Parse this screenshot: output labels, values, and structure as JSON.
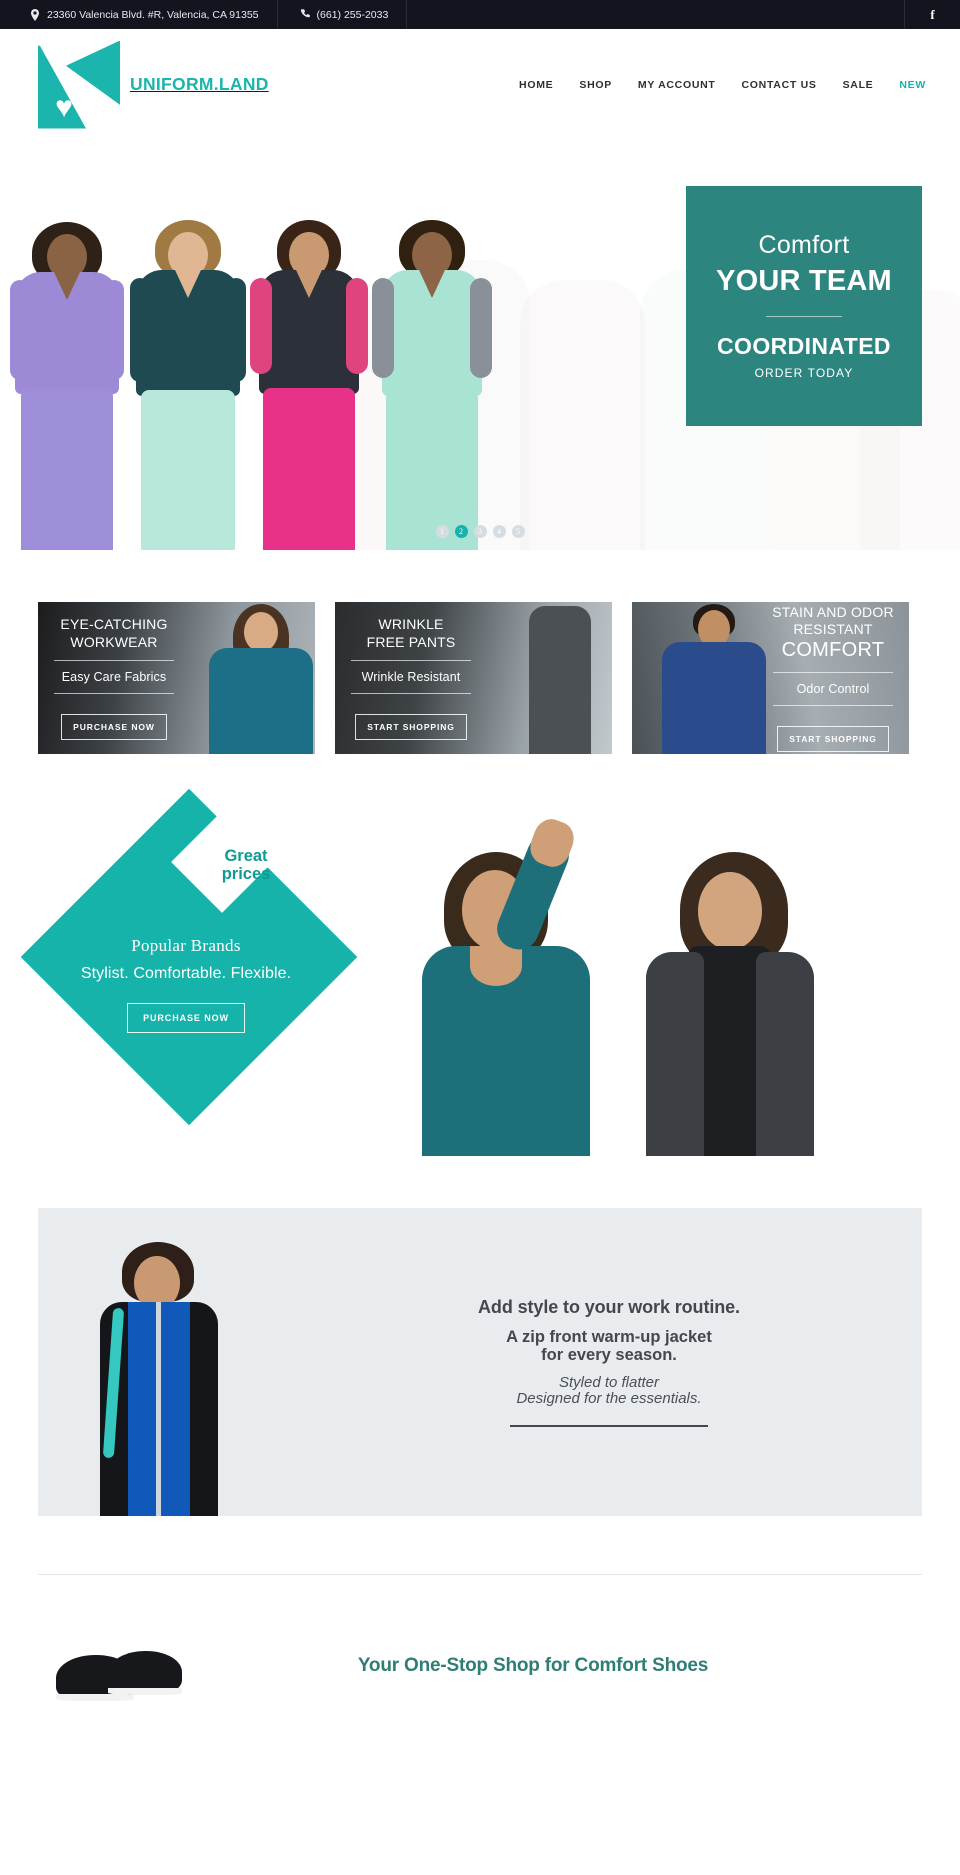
{
  "topbar": {
    "address": "23360 Valencia Blvd. #R, Valencia, CA 91355",
    "phone": "(661) 255-2033",
    "address_icon": "map-pin-icon",
    "phone_icon": "phone-icon",
    "social_icon": "facebook-icon",
    "facebook_glyph": "f",
    "bg_color": "#14141f"
  },
  "header": {
    "brand_name": "UNIFORM.LAND",
    "brand_color": "#1bb5ad",
    "nav": [
      {
        "label": "HOME",
        "active": false
      },
      {
        "label": "SHOP",
        "active": false
      },
      {
        "label": "MY ACCOUNT",
        "active": false
      },
      {
        "label": "CONTACT US",
        "active": false
      },
      {
        "label": "SALE",
        "active": false
      },
      {
        "label": "NEW",
        "active": true
      }
    ]
  },
  "hero": {
    "card": {
      "line1": "Comfort",
      "line2": "YOUR TEAM",
      "line3": "COORDINATED",
      "line4": "ORDER TODAY",
      "bg_color": "#2d8580"
    },
    "dots": [
      {
        "label": "1",
        "active": false
      },
      {
        "label": "2",
        "active": true
      },
      {
        "label": "3",
        "active": false
      },
      {
        "label": "4",
        "active": false
      },
      {
        "label": "5",
        "active": false
      }
    ],
    "active_dot_color": "#16b3ab"
  },
  "promos": [
    {
      "title": "EYE-CATCHING\nWORKWEAR",
      "title_line1": "EYE-CATCHING",
      "title_line2": "WORKWEAR",
      "subtitle": "Easy Care Fabrics",
      "button": "PURCHASE NOW"
    },
    {
      "title_line1": "WRINKLE",
      "title_line2": "FREE PANTS",
      "subtitle": "Wrinkle Resistant",
      "button": "START SHOPPING"
    },
    {
      "title_line1": "STAIN AND ODOR",
      "title_line2": "RESISTANT",
      "title_line3": "COMFORT",
      "subtitle": "Odor Control",
      "button": "START SHOPPING"
    }
  ],
  "diamond": {
    "badge_line1": "Great",
    "badge_line2": "prices",
    "badge_color": "#0f9a93",
    "heading": "Popular Brands",
    "tagline": "Stylist. Comfortable. Flexible.",
    "button": "PURCHASE NOW",
    "bg_color": "#16b3ab"
  },
  "jacket": {
    "line1": "Add style to your work routine.",
    "line2a": "A zip front warm-up jacket",
    "line2b": "for every season.",
    "line3a": "Styled to flatter",
    "line3b": "Designed for the essentials.",
    "bg_color": "#e8ecef"
  },
  "shoes": {
    "title": "Your One-Stop Shop for Comfort Shoes",
    "title_color": "#2f7e75"
  }
}
